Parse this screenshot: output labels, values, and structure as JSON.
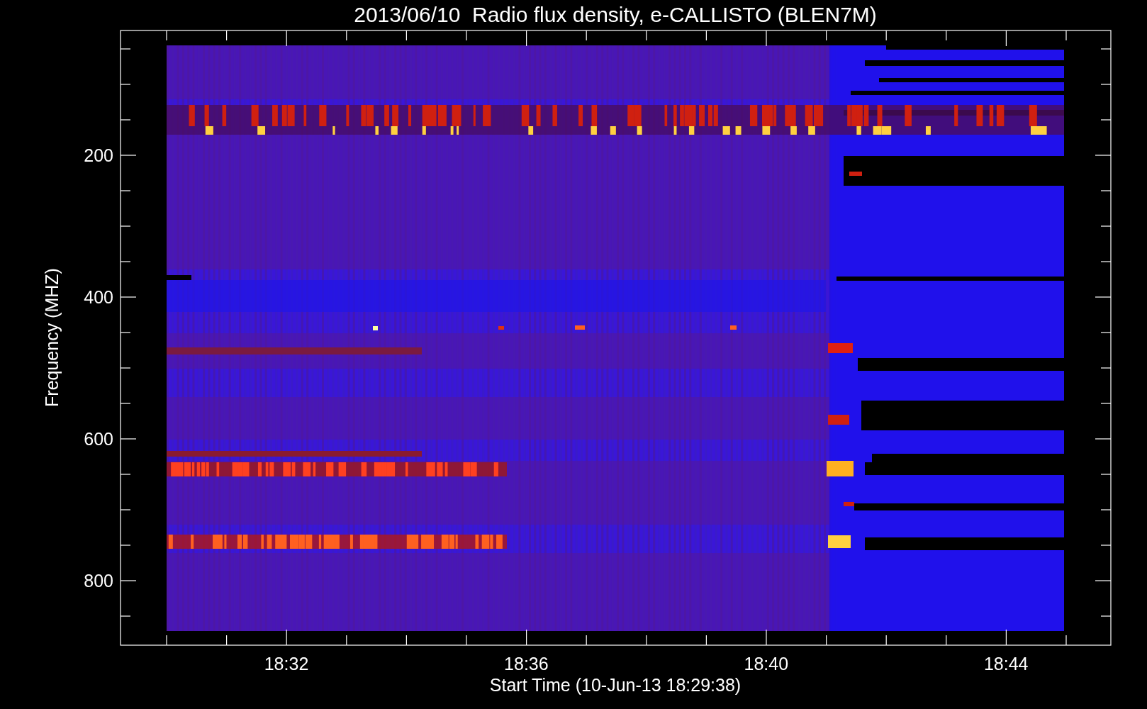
{
  "title": "2013/06/10  Radio flux density, e-CALLISTO (BLEN7M)",
  "y_axis": {
    "label": "Frequency (MHZ)",
    "ticks": [
      "200",
      "400",
      "600",
      "800"
    ]
  },
  "x_axis": {
    "label": "Start Time (10-Jun-13 18:29:38)",
    "ticks": [
      "18:32",
      "18:36",
      "18:40",
      "18:44"
    ]
  }
}
